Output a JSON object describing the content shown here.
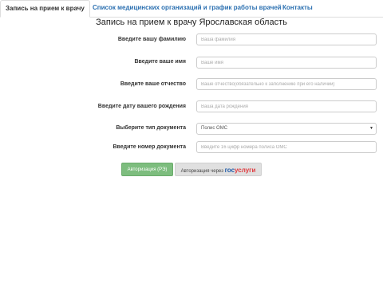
{
  "tabs": [
    {
      "label": "Запись на прием к врачу",
      "active": true
    },
    {
      "label": "Список медицинских организаций и график работы врачей",
      "active": false
    },
    {
      "label": "Контакты",
      "active": false
    }
  ],
  "page_title": "Запись на прием к врачу Ярославская область",
  "form": {
    "surname": {
      "label": "Введите вашу фамилию",
      "placeholder": "Ваша фамилия"
    },
    "name": {
      "label": "Введите ваше имя",
      "placeholder": "Ваше имя"
    },
    "patronymic": {
      "label": "Введите ваше отчество",
      "placeholder": "Ваше отчество(обязательно к заполнению при его наличии)"
    },
    "birthdate": {
      "label": "Введите дату вашего рождения",
      "placeholder": "Ваша дата рождения"
    },
    "doc_type": {
      "label": "Выберите тип документа",
      "value": "Полис ОМС"
    },
    "doc_number": {
      "label": "Введите номер документа",
      "placeholder": "Введите 16 цифр номера полиса ОМС"
    }
  },
  "buttons": {
    "auth_label": "Авторизация (РЭ)",
    "gosuslugi_prefix": "Авторизация через",
    "gosuslugi_brand_1": "гос",
    "gosuslugi_brand_2": "услуги"
  },
  "colors": {
    "tab_link": "#2a6fb0",
    "auth_button": "#7dbd7e",
    "gosuslugi_blue": "#1e5aa8",
    "gosuslugi_red": "#e03a3e"
  }
}
